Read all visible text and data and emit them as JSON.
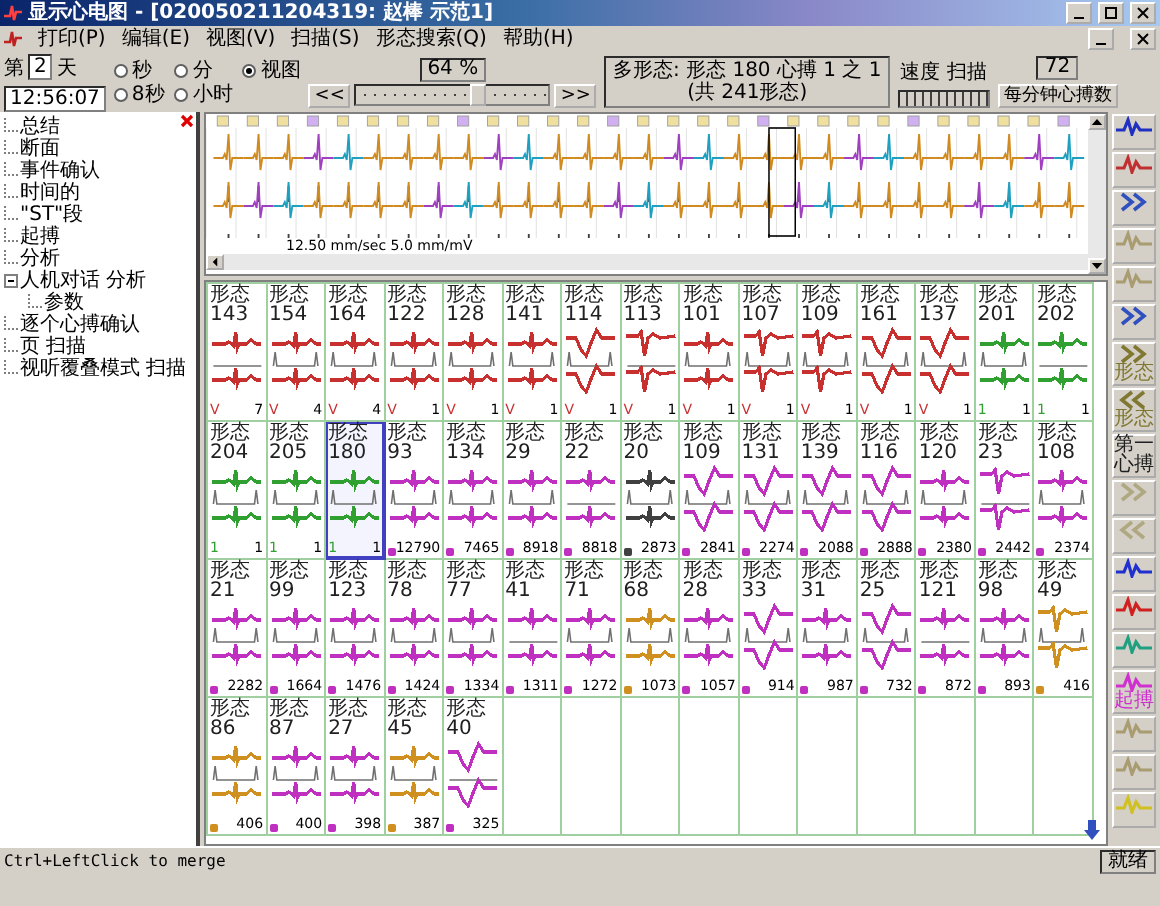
{
  "window": {
    "title": "显示心电图 - [020050211204319: 赵棒 示范1]"
  },
  "menu": [
    "打印(P)",
    "编辑(E)",
    "视图(V)",
    "扫描(S)",
    "形态搜索(Q)",
    "帮助(H)"
  ],
  "toolbar": {
    "day_prefix": "第",
    "day_value": "2",
    "day_suffix": "天",
    "time": "12:56:07",
    "view_options": [
      {
        "label": "秒",
        "selected": false
      },
      {
        "label": "分",
        "selected": false
      },
      {
        "label": "视图",
        "selected": true
      },
      {
        "label": "8秒",
        "selected": false
      },
      {
        "label": "小时",
        "selected": false
      }
    ],
    "position_reading": "64 %",
    "position_slider": {
      "level": 0.64
    },
    "prev_button": "<<",
    "next_button": ">>",
    "morphology_info": [
      "多形态: 形态 180 心搏 1 之 1",
      "(共 241形态)"
    ],
    "speed_label": "速度  扫描",
    "heart_rate": "72",
    "heart_rate_button": "每分钟心搏数"
  },
  "tree": [
    {
      "label": "总结"
    },
    {
      "label": "断面"
    },
    {
      "label": "事件确认"
    },
    {
      "label": "时间的"
    },
    {
      "label": "\"ST\"段"
    },
    {
      "label": "起搏"
    },
    {
      "label": "分析"
    },
    {
      "label": "人机对话 分析",
      "expanded": true,
      "children": [
        {
          "label": "参数"
        }
      ]
    },
    {
      "label": "逐个心搏确认"
    },
    {
      "label": "页 扫描"
    },
    {
      "label": "视听覆叠模式 扫描"
    }
  ],
  "strip": {
    "caption": "12.50 mm/sec 5.0 mm/mV"
  },
  "templates": [
    {
      "label": "形态143",
      "mark": "V",
      "count": "7",
      "color": "#c83030",
      "kind": "narrow",
      "selected": false
    },
    {
      "label": "形态154",
      "mark": "V",
      "count": "4",
      "color": "#c83030",
      "kind": "narrow",
      "selected": false
    },
    {
      "label": "形态164",
      "mark": "V",
      "count": "4",
      "color": "#c83030",
      "kind": "narrow",
      "selected": false
    },
    {
      "label": "形态122",
      "mark": "V",
      "count": "1",
      "color": "#c83030",
      "kind": "narrow",
      "selected": false
    },
    {
      "label": "形态128",
      "mark": "V",
      "count": "1",
      "color": "#c83030",
      "kind": "narrow",
      "selected": false
    },
    {
      "label": "形态141",
      "mark": "V",
      "count": "1",
      "color": "#c83030",
      "kind": "narrow",
      "selected": false
    },
    {
      "label": "形态114",
      "mark": "V",
      "count": "1",
      "color": "#c83030",
      "kind": "wide",
      "selected": false
    },
    {
      "label": "形态113",
      "mark": "V",
      "count": "1",
      "color": "#c83030",
      "kind": "inverted",
      "selected": false
    },
    {
      "label": "形态101",
      "mark": "V",
      "count": "1",
      "color": "#c83030",
      "kind": "narrow",
      "selected": false
    },
    {
      "label": "形态107",
      "mark": "V",
      "count": "1",
      "color": "#c83030",
      "kind": "inverted",
      "selected": false
    },
    {
      "label": "形态109",
      "mark": "V",
      "count": "1",
      "color": "#c83030",
      "kind": "inverted",
      "selected": false
    },
    {
      "label": "形态161",
      "mark": "V",
      "count": "1",
      "color": "#c83030",
      "kind": "wide",
      "selected": false
    },
    {
      "label": "形态137",
      "mark": "V",
      "count": "1",
      "color": "#c83030",
      "kind": "wide",
      "selected": false
    },
    {
      "label": "形态201",
      "mark": "1",
      "count": "1",
      "color": "#30a030",
      "kind": "narrow",
      "selected": false
    },
    {
      "label": "形态202",
      "mark": "1",
      "count": "1",
      "color": "#30a030",
      "kind": "narrow",
      "selected": false
    },
    {
      "label": "形态204",
      "mark": "1",
      "count": "1",
      "color": "#30a030",
      "kind": "narrow",
      "selected": false
    },
    {
      "label": "形态205",
      "mark": "1",
      "count": "1",
      "color": "#30a030",
      "kind": "narrow",
      "selected": false
    },
    {
      "label": "形态180",
      "mark": "1",
      "count": "1",
      "color": "#30a030",
      "kind": "narrow",
      "selected": true
    },
    {
      "label": "形态93",
      "count": "12790",
      "color": "#c030c0",
      "kind": "narrow",
      "selected": false
    },
    {
      "label": "形态134",
      "count": "7465",
      "color": "#c030c0",
      "kind": "narrow",
      "selected": false
    },
    {
      "label": "形态29",
      "count": "8918",
      "color": "#c030c0",
      "kind": "narrow",
      "selected": false
    },
    {
      "label": "形态22",
      "count": "8818",
      "color": "#c030c0",
      "kind": "narrow",
      "selected": false
    },
    {
      "label": "形态20",
      "count": "2873",
      "color": "#404040",
      "kind": "narrow",
      "selected": false
    },
    {
      "label": "形态109",
      "count": "2841",
      "color": "#c030c0",
      "kind": "wide",
      "selected": false
    },
    {
      "label": "形态131",
      "count": "2274",
      "color": "#c030c0",
      "kind": "wide",
      "selected": false
    },
    {
      "label": "形态139",
      "count": "2088",
      "color": "#c030c0",
      "kind": "wide",
      "selected": false
    },
    {
      "label": "形态116",
      "count": "2888",
      "color": "#c030c0",
      "kind": "wide",
      "selected": false
    },
    {
      "label": "形态120",
      "count": "2380",
      "color": "#c030c0",
      "kind": "narrow",
      "selected": false
    },
    {
      "label": "形态23",
      "count": "2442",
      "color": "#c030c0",
      "kind": "inverted",
      "selected": false
    },
    {
      "label": "形态108",
      "count": "2374",
      "color": "#c030c0",
      "kind": "narrow",
      "selected": false
    },
    {
      "label": "形态21",
      "count": "2282",
      "color": "#c030c0",
      "kind": "narrow",
      "selected": false
    },
    {
      "label": "形态99",
      "count": "1664",
      "color": "#c030c0",
      "kind": "narrow",
      "selected": false
    },
    {
      "label": "形态123",
      "count": "1476",
      "color": "#c030c0",
      "kind": "narrow",
      "selected": false
    },
    {
      "label": "形态78",
      "count": "1424",
      "color": "#c030c0",
      "kind": "narrow",
      "selected": false
    },
    {
      "label": "形态77",
      "count": "1334",
      "color": "#c030c0",
      "kind": "narrow",
      "selected": false
    },
    {
      "label": "形态41",
      "count": "1311",
      "color": "#c030c0",
      "kind": "narrow",
      "selected": false
    },
    {
      "label": "形态71",
      "count": "1272",
      "color": "#c030c0",
      "kind": "narrow",
      "selected": false
    },
    {
      "label": "形态68",
      "count": "1073",
      "color": "#d09020",
      "kind": "narrow",
      "selected": false
    },
    {
      "label": "形态28",
      "count": "1057",
      "color": "#c030c0",
      "kind": "narrow",
      "selected": false
    },
    {
      "label": "形态33",
      "count": "914",
      "color": "#c030c0",
      "kind": "wide",
      "selected": false
    },
    {
      "label": "形态31",
      "count": "987",
      "color": "#c030c0",
      "kind": "narrow",
      "selected": false
    },
    {
      "label": "形态25",
      "count": "732",
      "color": "#c030c0",
      "kind": "wide",
      "selected": false
    },
    {
      "label": "形态121",
      "count": "872",
      "color": "#c030c0",
      "kind": "narrow",
      "selected": false
    },
    {
      "label": "形态98",
      "count": "893",
      "color": "#c030c0",
      "kind": "narrow",
      "selected": false
    },
    {
      "label": "形态49",
      "count": "416",
      "color": "#d09020",
      "kind": "inverted",
      "selected": false
    },
    {
      "label": "形态86",
      "count": "406",
      "color": "#d09020",
      "kind": "narrow",
      "selected": false
    },
    {
      "label": "形态87",
      "count": "400",
      "color": "#c030c0",
      "kind": "narrow",
      "selected": false
    },
    {
      "label": "形态27",
      "count": "398",
      "color": "#c030c0",
      "kind": "narrow",
      "selected": false
    },
    {
      "label": "形态45",
      "count": "387",
      "color": "#d09020",
      "kind": "narrow",
      "selected": false
    },
    {
      "label": "形态40",
      "count": "325",
      "color": "#c030c0",
      "kind": "wide",
      "selected": false
    }
  ],
  "side_toolbar": [
    {
      "kind": "wave",
      "color": "#2030c0"
    },
    {
      "kind": "wave",
      "color": "#c03030"
    },
    {
      "kind": "forward",
      "color": "#3050c0"
    },
    {
      "kind": "wave",
      "color": "#a89c70"
    },
    {
      "kind": "wave",
      "color": "#a89c70"
    },
    {
      "kind": "forward",
      "color": "#3050c0"
    },
    {
      "kind": "forward",
      "color": "#807830",
      "label": "形态"
    },
    {
      "kind": "back",
      "color": "#807830",
      "label": "形态"
    },
    {
      "kind": "text",
      "color": "#202020",
      "label": "第一心搏"
    },
    {
      "kind": "forward",
      "color": "#b0a880"
    },
    {
      "kind": "back",
      "color": "#b0a880"
    },
    {
      "kind": "wave",
      "color": "#2030d0"
    },
    {
      "kind": "wave",
      "color": "#d02020"
    },
    {
      "kind": "wave",
      "color": "#20a080"
    },
    {
      "kind": "wave",
      "color": "#d030d0",
      "label": "起搏"
    },
    {
      "kind": "wave",
      "color": "#a89c70"
    },
    {
      "kind": "wave",
      "color": "#a89c70"
    },
    {
      "kind": "wave",
      "color": "#d0c020"
    }
  ],
  "status_bar": {
    "message": "Ctrl+LeftClick to merge",
    "panel": "就绪"
  }
}
